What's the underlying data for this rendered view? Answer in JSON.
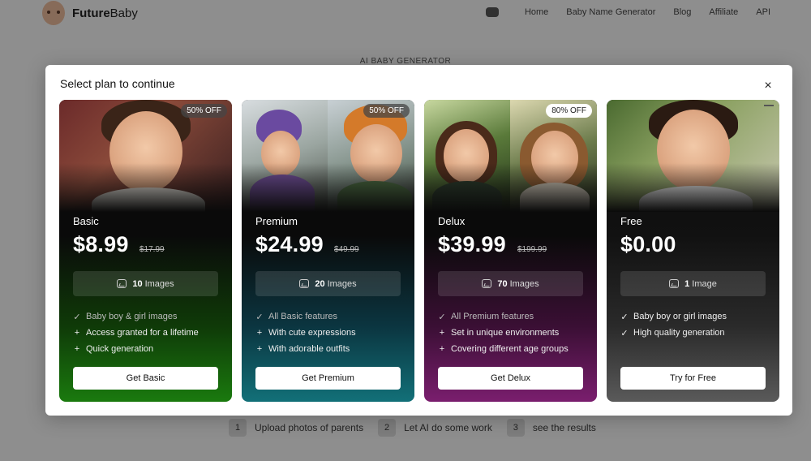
{
  "header": {
    "brand_part1": "Future",
    "brand_part2": "Baby",
    "nav": [
      "Home",
      "Baby Name Generator",
      "Blog",
      "Affiliate",
      "API"
    ]
  },
  "background": {
    "heading": "AI BABY GENERATOR",
    "steps": [
      {
        "num": "1",
        "label": "Upload photos of parents"
      },
      {
        "num": "2",
        "label": "Let AI do some work"
      },
      {
        "num": "3",
        "label": "see the results"
      }
    ]
  },
  "modal": {
    "title": "Select plan to continue",
    "close_symbol": "×",
    "plans": [
      {
        "name": "Basic",
        "price": "$8.99",
        "old_price": "$17.99",
        "badge": "50% OFF",
        "images_count": "10",
        "images_label": "Images",
        "features": [
          {
            "icon": "check-icon",
            "mark": "✓",
            "text": "Baby boy & girl images",
            "muted": true
          },
          {
            "icon": "plus-icon",
            "mark": "+",
            "text": "Access granted for a lifetime",
            "muted": false
          },
          {
            "icon": "plus-icon",
            "mark": "+",
            "text": "Quick generation",
            "muted": false
          }
        ],
        "cta": "Get Basic",
        "accent": "#1a7a0e"
      },
      {
        "name": "Premium",
        "price": "$24.99",
        "old_price": "$49.99",
        "badge": "50% OFF",
        "images_count": "20",
        "images_label": "Images",
        "features": [
          {
            "icon": "check-icon",
            "mark": "✓",
            "text": "All Basic features",
            "muted": true
          },
          {
            "icon": "plus-icon",
            "mark": "+",
            "text": "With cute expressions",
            "muted": false
          },
          {
            "icon": "plus-icon",
            "mark": "+",
            "text": "With adorable outfits",
            "muted": false
          }
        ],
        "cta": "Get Premium",
        "accent": "#127078"
      },
      {
        "name": "Delux",
        "price": "$39.99",
        "old_price": "$199.99",
        "badge": "80% OFF",
        "images_count": "70",
        "images_label": "Images",
        "features": [
          {
            "icon": "check-icon",
            "mark": "✓",
            "text": "All Premium features",
            "muted": true
          },
          {
            "icon": "plus-icon",
            "mark": "+",
            "text": "Set in unique environments",
            "muted": false
          },
          {
            "icon": "plus-icon",
            "mark": "+",
            "text": "Covering different age groups",
            "muted": false
          }
        ],
        "cta": "Get Delux",
        "accent": "#7a1e6e"
      },
      {
        "name": "Free",
        "price": "$0.00",
        "old_price": "",
        "badge": "",
        "images_count": "1",
        "images_label": "Image",
        "features": [
          {
            "icon": "check-icon",
            "mark": "✓",
            "text": "Baby boy or girl images",
            "muted": false
          },
          {
            "icon": "check-icon",
            "mark": "✓",
            "text": "High quality generation",
            "muted": false
          }
        ],
        "cta": "Try for Free",
        "accent": "#5a5a5a"
      }
    ]
  }
}
